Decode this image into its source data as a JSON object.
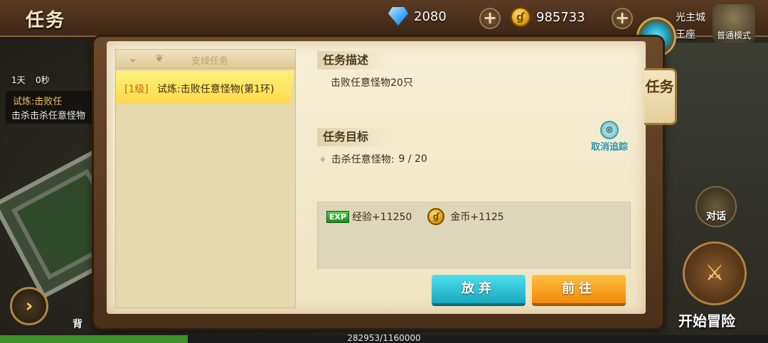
{
  "header": {
    "title": "任务",
    "diamonds": "2080",
    "gold": "985733",
    "gem_icon": "diamond-icon",
    "coin_icon": "gold-coin-icon"
  },
  "map": {
    "city": "光主城",
    "zone": "王座",
    "mode": "普通模式"
  },
  "hud_left": {
    "time_days": "1天",
    "time_seconds": "0秒",
    "track_title": "试炼:击败任",
    "track_desc": "击杀击杀任意怪物"
  },
  "task_list": {
    "header_label": "支线任务",
    "items": [
      {
        "level": "[1级]",
        "name": "试炼:击败任意怪物(第1环)",
        "selected": true
      }
    ]
  },
  "detail": {
    "desc_heading": "任务描述",
    "desc_text": "击败任意怪物20只",
    "goal_heading": "任务目标",
    "goal_label": "击杀任意怪物:",
    "goal_progress": "9 / 20",
    "cancel_track": "取消追踪"
  },
  "rewards": {
    "exp_badge": "EXP",
    "exp_text": "经验+11250",
    "gold_text": "金币+1125"
  },
  "buttons": {
    "abandon": "放弃",
    "goto": "前往"
  },
  "side_tab": "任务",
  "hud_right": {
    "talk": "对话",
    "adventure": "开始冒险"
  },
  "bottom": {
    "bag": "背",
    "exp_text": "282953/1160000",
    "exp_fraction": 0.244
  },
  "colors": {
    "accent_teal": "#1ba8c0",
    "accent_orange": "#f08a0a",
    "selected_item": "#ffd94a"
  }
}
